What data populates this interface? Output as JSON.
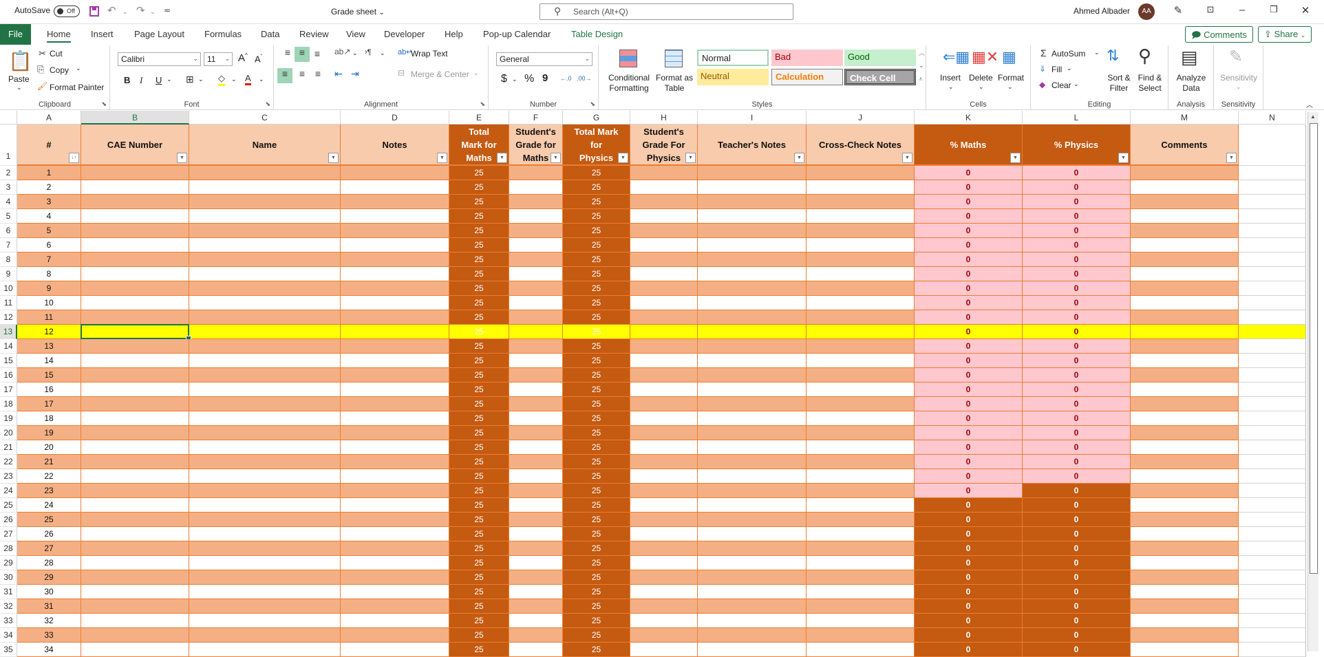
{
  "titlebar": {
    "autosave_label": "AutoSave",
    "autosave_state": "Off",
    "document_title": "Grade sheet",
    "search_placeholder": "Search (Alt+Q)",
    "user_name": "Ahmed Albader",
    "user_initials": "AA"
  },
  "menu": {
    "file": "File",
    "tabs": [
      "Home",
      "Insert",
      "Page Layout",
      "Formulas",
      "Data",
      "Review",
      "View",
      "Developer",
      "Help",
      "Pop-up Calendar",
      "Table Design"
    ],
    "active_tab": "Home",
    "comments": "Comments",
    "share": "Share"
  },
  "ribbon": {
    "clipboard": {
      "label": "Clipboard",
      "paste": "Paste",
      "cut": "Cut",
      "copy": "Copy",
      "format_painter": "Format Painter"
    },
    "font": {
      "label": "Font",
      "font_name": "Calibri",
      "font_size": "11",
      "bold": "B",
      "italic": "I",
      "underline": "U"
    },
    "alignment": {
      "label": "Alignment",
      "wrap_text": "Wrap Text",
      "merge_center": "Merge & Center"
    },
    "number": {
      "label": "Number",
      "format": "General",
      "currency": "$",
      "percent": "%",
      "comma": "9"
    },
    "styles": {
      "label": "Styles",
      "conditional_formatting": "Conditional Formatting",
      "format_as_table": "Format as Table",
      "gallery": [
        {
          "name": "Normal",
          "bg": "#ffffff",
          "fg": "#000000"
        },
        {
          "name": "Bad",
          "bg": "#ffc7ce",
          "fg": "#9c0006"
        },
        {
          "name": "Good",
          "bg": "#c6efce",
          "fg": "#006100"
        },
        {
          "name": "Neutral",
          "bg": "#ffeb9c",
          "fg": "#9c5700"
        },
        {
          "name": "Calculation",
          "bg": "#f2f2f2",
          "fg": "#fa7d00"
        },
        {
          "name": "Check Cell",
          "bg": "#a5a5a5",
          "fg": "#ffffff"
        }
      ]
    },
    "cells": {
      "label": "Cells",
      "insert": "Insert",
      "delete": "Delete",
      "format": "Format"
    },
    "editing": {
      "label": "Editing",
      "autosum": "AutoSum",
      "fill": "Fill",
      "clear": "Clear",
      "sort_filter": "Sort & Filter",
      "find_select": "Find & Select"
    },
    "analysis": {
      "label": "Analysis",
      "analyze_data": "Analyze Data"
    },
    "sensitivity": {
      "label": "Sensitivity",
      "sensitivity_btn": "Sensitivity"
    }
  },
  "sheet": {
    "column_letters": [
      "A",
      "B",
      "C",
      "D",
      "E",
      "F",
      "G",
      "H",
      "I",
      "J",
      "K",
      "L",
      "M",
      "N"
    ],
    "selected_column": "B",
    "selected_row": 13,
    "active_cell": "B13",
    "headers": [
      "#",
      "CAE Number",
      "Name",
      "Notes",
      "Total Mark for Maths",
      "Student's Grade for Maths",
      "Total Mark for Physics",
      "Student's Grade For Physics",
      "Teacher's Notes",
      "Cross-Check Notes",
      "% Maths",
      "% Physics",
      "Comments"
    ],
    "rows": [
      {
        "n": "1",
        "e": "25",
        "g": "25",
        "k": "0",
        "l": "0"
      },
      {
        "n": "2",
        "e": "25",
        "g": "25",
        "k": "0",
        "l": "0"
      },
      {
        "n": "3",
        "e": "25",
        "g": "25",
        "k": "0",
        "l": "0"
      },
      {
        "n": "4",
        "e": "25",
        "g": "25",
        "k": "0",
        "l": "0"
      },
      {
        "n": "5",
        "e": "25",
        "g": "25",
        "k": "0",
        "l": "0"
      },
      {
        "n": "6",
        "e": "25",
        "g": "25",
        "k": "0",
        "l": "0"
      },
      {
        "n": "7",
        "e": "25",
        "g": "25",
        "k": "0",
        "l": "0"
      },
      {
        "n": "8",
        "e": "25",
        "g": "25",
        "k": "0",
        "l": "0"
      },
      {
        "n": "9",
        "e": "25",
        "g": "25",
        "k": "0",
        "l": "0"
      },
      {
        "n": "10",
        "e": "25",
        "g": "25",
        "k": "0",
        "l": "0"
      },
      {
        "n": "11",
        "e": "25",
        "g": "25",
        "k": "0",
        "l": "0"
      },
      {
        "n": "12",
        "e": "25",
        "g": "25",
        "k": "0",
        "l": "0"
      },
      {
        "n": "13",
        "e": "25",
        "g": "25",
        "k": "0",
        "l": "0"
      },
      {
        "n": "14",
        "e": "25",
        "g": "25",
        "k": "0",
        "l": "0"
      },
      {
        "n": "15",
        "e": "25",
        "g": "25",
        "k": "0",
        "l": "0"
      },
      {
        "n": "16",
        "e": "25",
        "g": "25",
        "k": "0",
        "l": "0"
      },
      {
        "n": "17",
        "e": "25",
        "g": "25",
        "k": "0",
        "l": "0"
      },
      {
        "n": "18",
        "e": "25",
        "g": "25",
        "k": "0",
        "l": "0"
      },
      {
        "n": "19",
        "e": "25",
        "g": "25",
        "k": "0",
        "l": "0"
      },
      {
        "n": "20",
        "e": "25",
        "g": "25",
        "k": "0",
        "l": "0"
      },
      {
        "n": "21",
        "e": "25",
        "g": "25",
        "k": "0",
        "l": "0"
      },
      {
        "n": "22",
        "e": "25",
        "g": "25",
        "k": "0",
        "l": "0"
      },
      {
        "n": "23",
        "e": "25",
        "g": "25",
        "k": "0",
        "l": "0"
      },
      {
        "n": "24",
        "e": "25",
        "g": "25",
        "k": "0",
        "l": "0"
      },
      {
        "n": "25",
        "e": "25",
        "g": "25",
        "k": "0",
        "l": "0"
      },
      {
        "n": "26",
        "e": "25",
        "g": "25",
        "k": "0",
        "l": "0"
      },
      {
        "n": "27",
        "e": "25",
        "g": "25",
        "k": "0",
        "l": "0"
      },
      {
        "n": "28",
        "e": "25",
        "g": "25",
        "k": "0",
        "l": "0"
      },
      {
        "n": "29",
        "e": "25",
        "g": "25",
        "k": "0",
        "l": "0"
      },
      {
        "n": "30",
        "e": "25",
        "g": "25",
        "k": "0",
        "l": "0"
      },
      {
        "n": "31",
        "e": "25",
        "g": "25",
        "k": "0",
        "l": "0"
      },
      {
        "n": "32",
        "e": "25",
        "g": "25",
        "k": "0",
        "l": "0"
      },
      {
        "n": "33",
        "e": "25",
        "g": "25",
        "k": "0",
        "l": "0"
      },
      {
        "n": "34",
        "e": "25",
        "g": "25",
        "k": "0",
        "l": "0"
      }
    ],
    "pink_k_last_item": 23,
    "pink_l_last_item": 22,
    "colors": {
      "band": "#f4b084",
      "header_light": "#f8cbad",
      "header_dark": "#c55a11",
      "border": "#ed7d31",
      "pink": "#ffc7ce",
      "pink_text": "#9c0006",
      "highlight_row": "#ffff00",
      "accent": "#217346"
    }
  }
}
